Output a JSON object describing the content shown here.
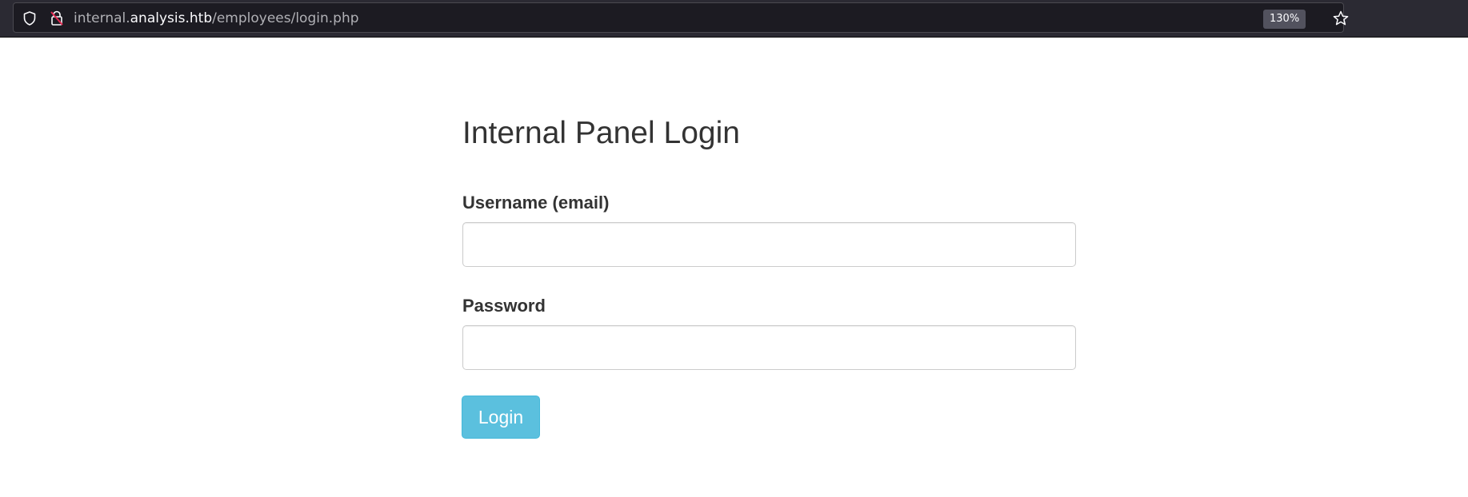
{
  "browser": {
    "url": {
      "prefix": "internal.",
      "host": "analysis.htb",
      "path": "/employees/login.php"
    },
    "zoom": "130%",
    "icons": {
      "tracking_protection": "shield-icon",
      "connection": "insecure-lock-icon",
      "bookmark": "star-icon"
    },
    "colors": {
      "toolbar": "#2b2a33",
      "urlbar": "#1c1b22",
      "insecure_lock_strike": "#e22850"
    }
  },
  "login_form": {
    "title": "Internal Panel Login",
    "username_label": "Username (email)",
    "username_value": "",
    "password_label": "Password",
    "password_value": "",
    "submit_label": "Login",
    "colors": {
      "button": "#5bc0de",
      "text": "#333333"
    }
  }
}
